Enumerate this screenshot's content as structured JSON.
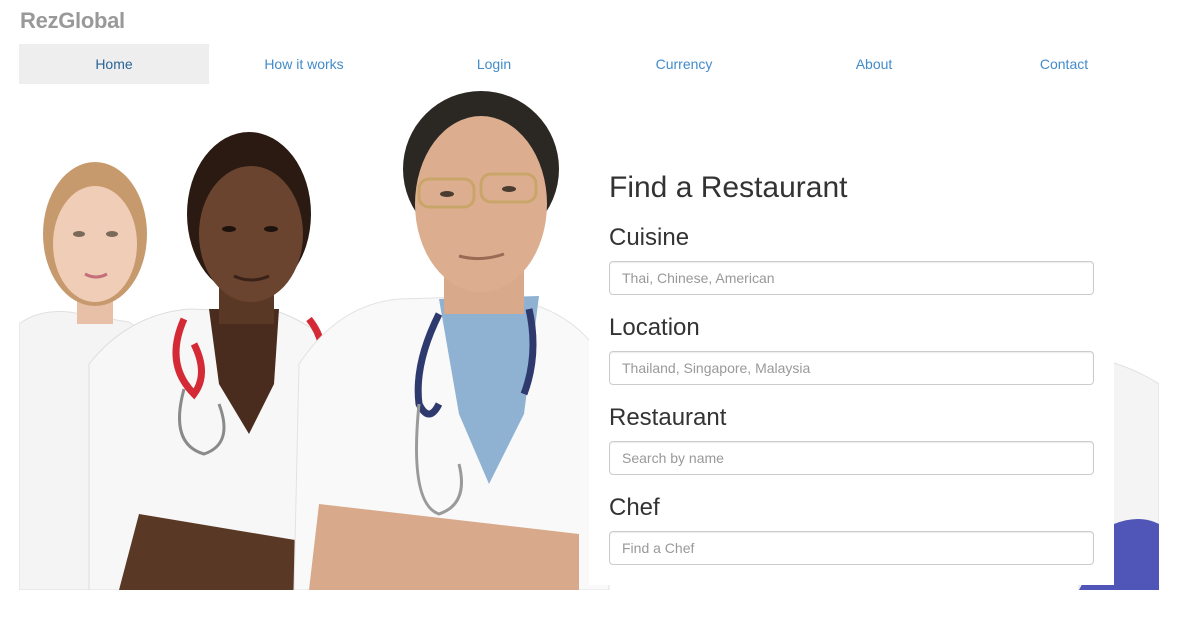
{
  "brand": "RezGlobal",
  "nav": {
    "items": [
      {
        "label": "Home",
        "active": true
      },
      {
        "label": "How it works",
        "active": false
      },
      {
        "label": "Login",
        "active": false
      },
      {
        "label": "Currency",
        "active": false
      },
      {
        "label": "About",
        "active": false
      },
      {
        "label": "Contact",
        "active": false
      }
    ]
  },
  "search_panel": {
    "title": "Find a Restaurant",
    "fields": [
      {
        "label": "Cuisine",
        "placeholder": "Thai, Chinese, American"
      },
      {
        "label": "Location",
        "placeholder": "Thailand, Singapore, Malaysia"
      },
      {
        "label": "Restaurant",
        "placeholder": "Search by name"
      },
      {
        "label": "Chef",
        "placeholder": "Find a Chef"
      }
    ]
  },
  "colors": {
    "link": "#428bca",
    "active_nav_bg": "#eeeeee",
    "brand": "#999999"
  }
}
